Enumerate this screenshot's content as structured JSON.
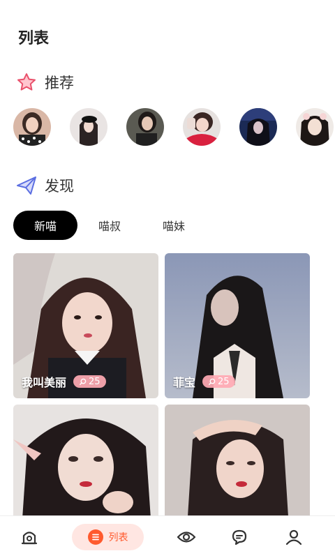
{
  "page": {
    "title": "列表"
  },
  "recommend": {
    "title": "推荐",
    "icon": "star-icon"
  },
  "discover": {
    "title": "发现",
    "icon": "paper-plane-icon"
  },
  "tabs": [
    {
      "label": "新喵",
      "active": true
    },
    {
      "label": "喵叔",
      "active": false
    },
    {
      "label": "喵妹",
      "active": false
    }
  ],
  "cards": [
    {
      "name": "我叫美丽",
      "count": "25"
    },
    {
      "name": "菲宝",
      "count": "25"
    },
    {
      "name": "",
      "count": ""
    },
    {
      "name": "",
      "count": ""
    }
  ],
  "tabbar": {
    "items": [
      {
        "icon": "home-icon"
      },
      {
        "icon": "list-icon",
        "label": "列表",
        "active": true
      },
      {
        "icon": "eye-icon"
      },
      {
        "icon": "chat-icon"
      },
      {
        "icon": "user-icon"
      }
    ]
  },
  "colors": {
    "accent": "#ff5a2e",
    "accent_bg": "#ffe6e2",
    "active_tab": "#000000",
    "badge": "#ffaab4"
  }
}
